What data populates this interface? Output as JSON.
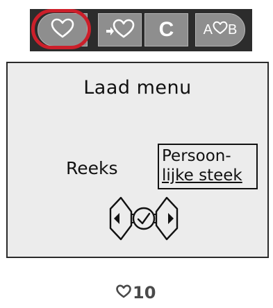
{
  "toolbar": {
    "buttons": [
      {
        "icon": "heart-icon"
      },
      {
        "icon": "load-heart-icon"
      },
      {
        "label": "C"
      },
      {
        "label_a": "A",
        "label_b": "B",
        "icon": "heart-icon"
      }
    ],
    "highlight_color": "#cc1f2a"
  },
  "screen": {
    "title": "Laad menu",
    "option_left": "Reeks",
    "option_right_line1": "Persoon-",
    "option_right_line2": "lijke steek"
  },
  "counter": {
    "value": "10",
    "icon": "heart-icon"
  }
}
